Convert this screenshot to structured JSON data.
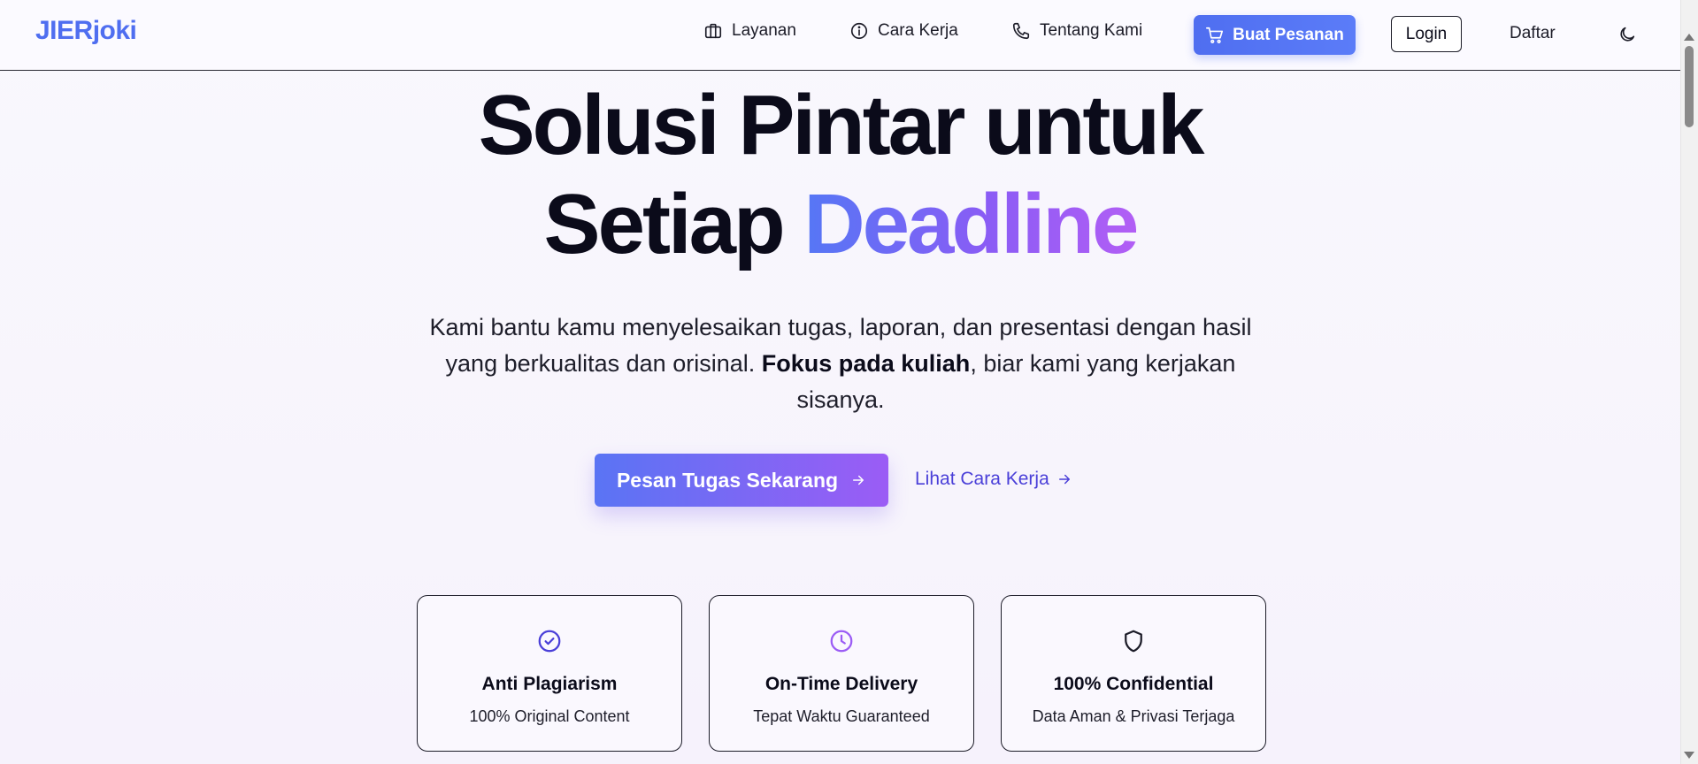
{
  "nav": {
    "logo": "JIERjoki",
    "items": [
      {
        "label": "Layanan",
        "icon": "briefcase-icon"
      },
      {
        "label": "Cara Kerja",
        "icon": "info-icon"
      },
      {
        "label": "Tentang Kami",
        "icon": "phone-icon"
      }
    ],
    "order_button": "Buat Pesanan",
    "login": "Login",
    "register": "Daftar",
    "theme_icon": "moon-icon"
  },
  "hero": {
    "title_line1": "Solusi Pintar untuk",
    "title_line2_plain": "Setiap ",
    "title_line2_accent": "Deadline",
    "subtitle_part1": "Kami bantu kamu menyelesaikan tugas, laporan, dan presentasi dengan hasil yang berkualitas dan orisinal. ",
    "subtitle_bold": "Fokus pada kuliah",
    "subtitle_part2": ", biar kami yang kerjakan sisanya.",
    "cta_primary": "Pesan Tugas Sekarang",
    "cta_secondary": "Lihat Cara Kerja"
  },
  "features": [
    {
      "title": "Anti Plagiarism",
      "subtitle": "100% Original Content",
      "icon": "check-circle-icon",
      "color": "#4a3fd8"
    },
    {
      "title": "On-Time Delivery",
      "subtitle": "Tepat Waktu Guaranteed",
      "icon": "clock-icon",
      "color": "#9b5cf5"
    },
    {
      "title": "100% Confidential",
      "subtitle": "Data Aman & Privasi Terjaga",
      "icon": "shield-icon",
      "color": "#1c1c28"
    }
  ],
  "colors": {
    "brand": "#4f6ef0",
    "accent_start": "#5577f5",
    "accent_end": "#b25ef5"
  }
}
